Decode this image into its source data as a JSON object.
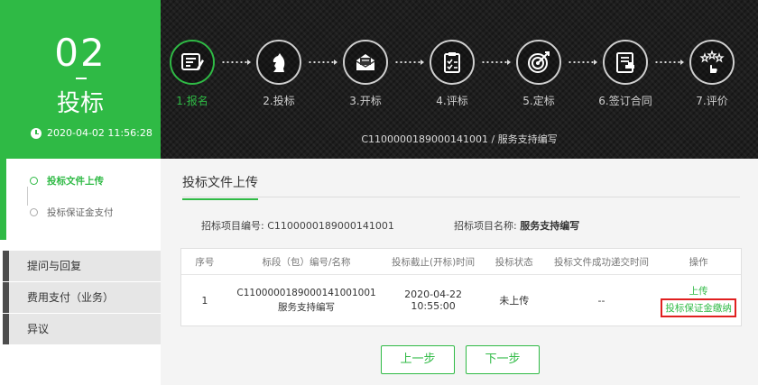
{
  "stage": {
    "number": "02",
    "name": "投标",
    "time": "2020-04-02 11:56:28"
  },
  "steps": [
    {
      "label": "1.报名",
      "icon": "registration-form-icon"
    },
    {
      "label": "2.投标",
      "icon": "knight-chess-icon"
    },
    {
      "label": "3.开标",
      "icon": "open-envelope-icon"
    },
    {
      "label": "4.评标",
      "icon": "clipboard-review-icon"
    },
    {
      "label": "5.定标",
      "icon": "target-dart-icon"
    },
    {
      "label": "6.签订合同",
      "icon": "contract-sign-icon"
    },
    {
      "label": "7.评价",
      "icon": "star-rating-icon"
    }
  ],
  "active_step": 0,
  "project_line": "C1100000189000141001 / 服务支持编写",
  "side_steps": [
    "投标文件上传",
    "投标保证金支付"
  ],
  "menu": [
    "提问与回复",
    "费用支付（业务）",
    "异议"
  ],
  "panel": {
    "title": "投标文件上传",
    "code_label": "招标项目编号:",
    "code_value": "C1100000189000141001",
    "name_label": "招标项目名称:",
    "name_value": "服务支持编写"
  },
  "table": {
    "headers": [
      "序号",
      "标段（包）编号/名称",
      "投标截止(开标)时间",
      "投标状态",
      "投标文件成功递交时间",
      "操作"
    ],
    "rows": [
      {
        "index": "1",
        "code": "C1100000189000141001001",
        "name": "服务支持编写",
        "deadline": "2020-04-22 10:55:00",
        "status": "未上传",
        "submitted": "--",
        "action_upload": "上传",
        "action_deposit": "投标保证金缴纳"
      }
    ]
  },
  "buttons": {
    "prev": "上一步",
    "next": "下一步"
  },
  "colors": {
    "accent": "#2fba45",
    "header_dark": "#1e1e1e",
    "highlight_border": "#e02020"
  }
}
